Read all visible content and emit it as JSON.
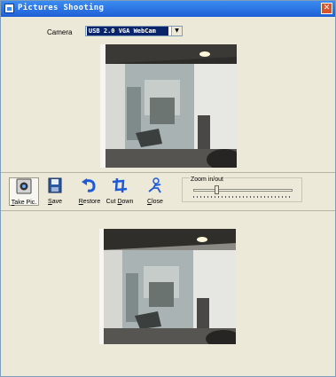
{
  "window": {
    "title": "Pictures Shooting",
    "close_glyph": "✕"
  },
  "camera": {
    "label": "Camera",
    "selected": "USB 2.0 VGA WebCam"
  },
  "toolbar": {
    "buttons": [
      {
        "label": "Take Pic.",
        "mnemonic": "T",
        "icon": "camera-icon"
      },
      {
        "label": "Save",
        "mnemonic": "S",
        "icon": "floppy-disk-icon"
      },
      {
        "label": "Restore",
        "mnemonic": "R",
        "icon": "undo-arrow-icon"
      },
      {
        "label": "Cut Down",
        "mnemonic": "D",
        "icon": "crop-icon"
      },
      {
        "label": "Close",
        "mnemonic": "C",
        "icon": "close-figure-icon"
      }
    ]
  },
  "zoom": {
    "label": "Zoom in/out",
    "value_fraction": 0.22
  },
  "colors": {
    "titlebar": "#1f5fd6",
    "background": "#ece9d8",
    "selection": "#0a246a"
  }
}
